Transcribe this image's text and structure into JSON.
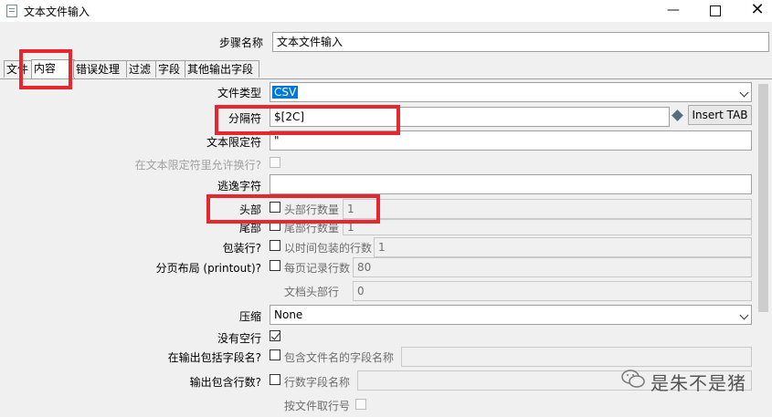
{
  "window": {
    "title": "文本文件输入"
  },
  "step": {
    "label": "步骤名称",
    "value": "文本文件输入"
  },
  "tabs": [
    "文件",
    "内容",
    "错误处理",
    "过滤",
    "字段",
    "其他输出字段"
  ],
  "form": {
    "file_type": {
      "label": "文件类型",
      "value": "CSV"
    },
    "separator": {
      "label": "分隔符",
      "value": "$[2C]",
      "insert_tab": "Insert TAB"
    },
    "enclosure": {
      "label": "文本限定符",
      "value": "\""
    },
    "allow_breaks": {
      "label": "在文本限定符里允许换行?"
    },
    "escape": {
      "label": "逃逸字符",
      "value": ""
    },
    "header": {
      "label": "头部",
      "sub_label": "头部行数量",
      "value": "1"
    },
    "footer": {
      "label": "尾部",
      "sub_label": "尾部行数量",
      "value": "1"
    },
    "wrapped": {
      "label": "包装行?",
      "sub_label": "以时间包装的行数",
      "value": "1"
    },
    "layout": {
      "label": "分页布局 (printout)?",
      "sub_label": "每页记录行数",
      "value": "80",
      "doc_header_label": "文档头部行",
      "doc_header_value": "0"
    },
    "compression": {
      "label": "压缩",
      "value": "None"
    },
    "no_empty_rows": {
      "label": "没有空行",
      "checked": true
    },
    "include_filename": {
      "label": "在输出包括字段名?",
      "sub_label": "包含文件名的字段名称"
    },
    "include_rownum": {
      "label": "输出包含行数?",
      "sub_label": "行数字段名称",
      "per_file_label": "按文件取行号"
    }
  },
  "watermark": {
    "text": "是朱不是猪"
  }
}
